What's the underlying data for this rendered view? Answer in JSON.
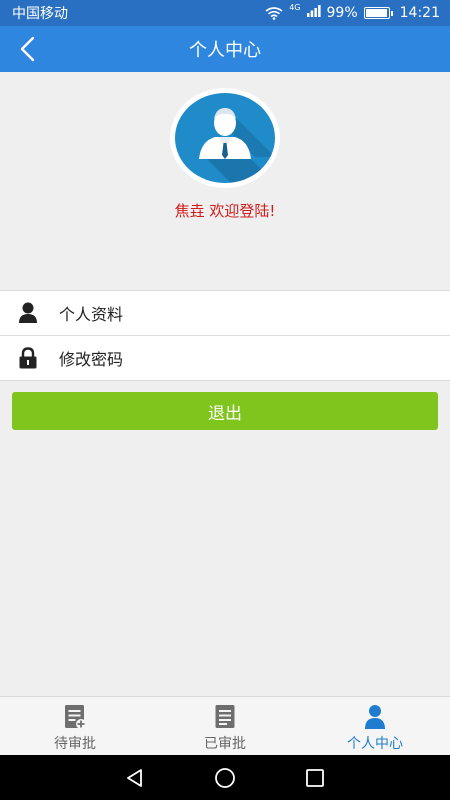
{
  "status_bar": {
    "carrier": "中国移动",
    "network": "4G",
    "battery": "99%",
    "battery_level": 0.99,
    "time": "14:21"
  },
  "header": {
    "title": "个人中心",
    "back_icon": "chevron-left-icon"
  },
  "profile": {
    "welcome": "焦垚 欢迎登陆!"
  },
  "menu": {
    "items": [
      {
        "label": "个人资料",
        "icon": "person-icon"
      },
      {
        "label": "修改密码",
        "icon": "lock-icon"
      }
    ]
  },
  "logout": {
    "label": "退出"
  },
  "tabs": [
    {
      "label": "待审批",
      "icon": "document-add-icon",
      "active": false
    },
    {
      "label": "已审批",
      "icon": "document-icon",
      "active": false
    },
    {
      "label": "个人中心",
      "icon": "person-icon",
      "active": true
    }
  ],
  "colors": {
    "header": "#2f86df",
    "status_bar": "#2a70c2",
    "welcome_text": "#d01b1b",
    "logout_button": "#7fc51d",
    "active_tab": "#1f7ccf"
  }
}
